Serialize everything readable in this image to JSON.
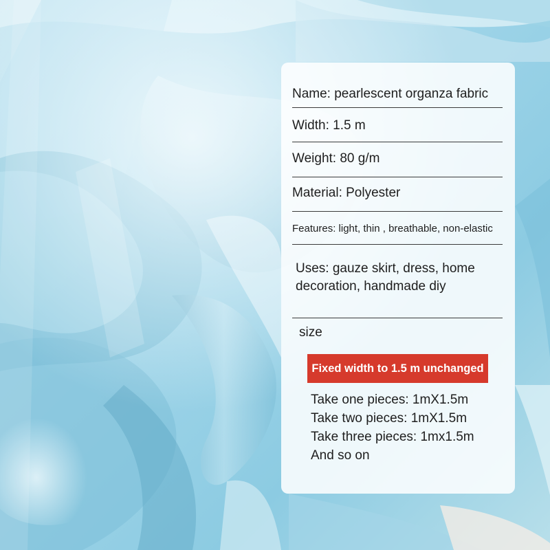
{
  "photo": {
    "subject": "pearlescent-organza-fabric",
    "dominant_color": "#8fd0e6",
    "highlight_color": "#e8f6fb",
    "shadow_color": "#4f9dbd"
  },
  "specs": {
    "name": "Name: pearlescent organza fabric",
    "width": "Width: 1.5 m",
    "weight": "Weight: 80 g/m",
    "material": "Material: Polyester",
    "features": "Features: light, thin , breathable, non-elastic",
    "uses": "Uses: gauze skirt, dress, home decoration, handmade diy"
  },
  "size": {
    "label": "size",
    "banner": "Fixed width to 1.5 m unchanged",
    "banner_color": "#d63a2c",
    "pieces": [
      "Take one pieces: 1mX1.5m",
      "Take two pieces: 1mX1.5m",
      "Take three pieces: 1mx1.5m",
      "And so on"
    ]
  }
}
